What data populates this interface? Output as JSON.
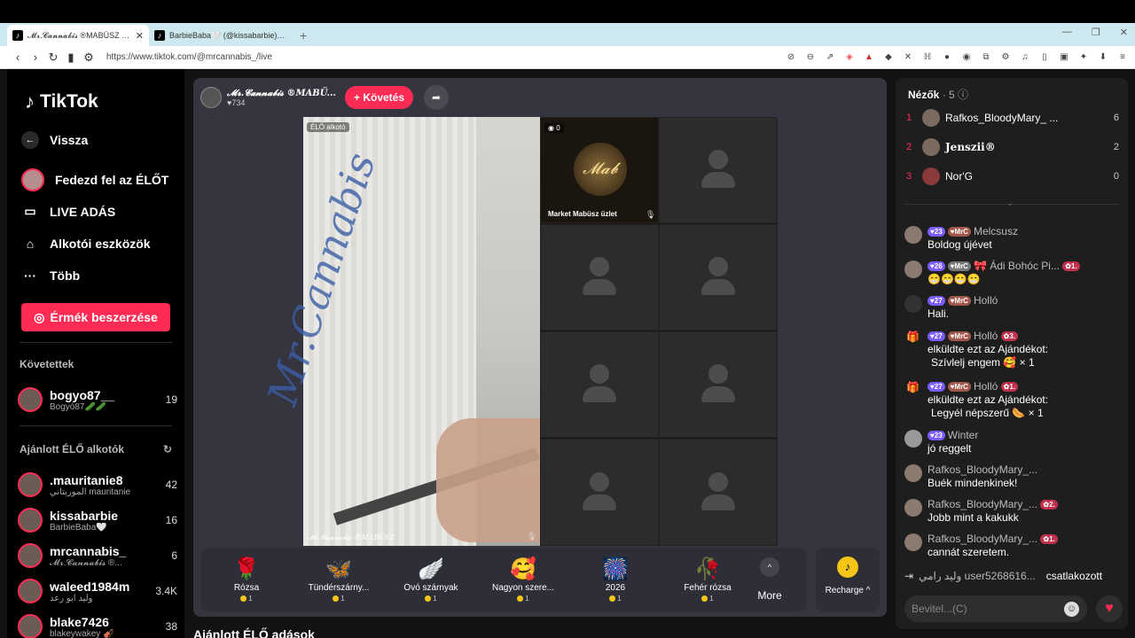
{
  "browser": {
    "tabs": [
      {
        "title": "𝓜𝓻.𝓒𝓪𝓷𝓷𝓪𝓫𝓲𝓼 ®MABÜSZ (@"
      },
      {
        "title": "BarbieBaba🤍 (@kissabarbie) ÉL"
      }
    ],
    "url": "https://www.tiktok.com/@mrcannabis_/live"
  },
  "sidebar": {
    "logo": "TikTok",
    "back": "Vissza",
    "nav": [
      {
        "label": "Fedezd fel az ÉLŐT",
        "icon": "avatar-icon"
      },
      {
        "label": "LIVE ADÁS",
        "icon": "video-icon"
      },
      {
        "label": "Alkotói eszközök",
        "icon": "creator-tools-icon"
      },
      {
        "label": "Több",
        "icon": "more-dots-icon"
      }
    ],
    "coins_button": "Érmék beszerzése",
    "following_header": "Követettek",
    "following": [
      {
        "name": "bogyo87__",
        "sub": "Bogyó87🥒🥒",
        "count": "19"
      }
    ],
    "recommended_header": "Ajánlott ÉLŐ alkotók",
    "recommended": [
      {
        "name": ".mauritanie8",
        "sub": "الموريتاني mauritanie",
        "count": "42"
      },
      {
        "name": "kissabarbie",
        "sub": "BarbieBaba🤍",
        "count": "16"
      },
      {
        "name": "mrcannabis_",
        "sub": "𝓜𝓻.𝓒𝓪𝓷𝓷𝓪𝓫𝓲𝓼 ®...",
        "count": "6"
      },
      {
        "name": "waleed1984m",
        "sub": "وليد ابو رعد",
        "count": "3.4K"
      },
      {
        "name": "blake7426",
        "sub": "blakeywakey 🎻",
        "count": "38"
      }
    ]
  },
  "stream": {
    "host_name": "𝓜𝓻.𝓒𝓪𝓷𝓷𝓪𝓫𝓲𝓼 ®MABÜ...",
    "host_likes": "♥734",
    "follow_button": "+ Követés",
    "live_creator_label": "ÉLŐ alkotó",
    "main_feed_name": "𝓜𝓻.𝓒𝓪𝓷𝓷𝓪𝓫𝓲𝓼 ®MABÜSZ",
    "guest_count": "0",
    "market_name": "Market Mabüsz üzlet"
  },
  "gifts": [
    {
      "name": "Rózsa",
      "price": "1",
      "icon": "🌹"
    },
    {
      "name": "Tündérszárny...",
      "price": "1",
      "icon": "🦋"
    },
    {
      "name": "Óvó szárnyak",
      "price": "1",
      "icon": "🪽"
    },
    {
      "name": "Nagyon szere...",
      "price": "1",
      "icon": "🥰"
    },
    {
      "name": "2026",
      "price": "1",
      "icon": "🎆"
    },
    {
      "name": "Fehér rózsa",
      "price": "1",
      "icon": "🥀"
    }
  ],
  "more_label": "More",
  "recharge_label": "Recharge ^",
  "recommended_lives_header": "Ajánlott ÉLŐ adások",
  "viewers": {
    "header": "Nézők",
    "count": "· 5",
    "list": [
      {
        "rank": "1",
        "name": "Rafkos_BloodyMary_ ...",
        "score": "6"
      },
      {
        "rank": "2",
        "name": "Jenszii®",
        "score": "2"
      },
      {
        "rank": "3",
        "name": "Nor'G",
        "score": "0"
      }
    ]
  },
  "chat": [
    {
      "level": "23",
      "club": "MrC",
      "name": "Melcsusz",
      "text": "Boldog újévet",
      "type": "msg"
    },
    {
      "level": "26",
      "club": "MrC",
      "name": "🎀 Ádi Bohóc Pi...",
      "rank": "1.",
      "text": "😁😁😁😁",
      "type": "msg"
    },
    {
      "level": "27",
      "club": "MrC",
      "name": "Holló",
      "text": "Hali.",
      "type": "msg"
    },
    {
      "level": "27",
      "club": "MrC",
      "name": "Holló",
      "rank": "3.",
      "text": "elküldte ezt az Ajándékot:",
      "text2": "Szívlelj engem 🥰 × 1",
      "type": "gift"
    },
    {
      "level": "27",
      "club": "MrC",
      "name": "Holló",
      "rank": "1.",
      "text": "elküldte ezt az Ajándékot:",
      "text2": "Legyél népszerű 🌭 × 1",
      "type": "gift"
    },
    {
      "level": "23",
      "name": "Winter",
      "text": "jó reggelt",
      "type": "msg"
    },
    {
      "name": "Rafkos_BloodyMary_...",
      "text": "Buék mindenkinek!",
      "type": "msg"
    },
    {
      "name": "Rafkos_BloodyMary_...",
      "rank": "2.",
      "text": "Jobb mint a kakukk",
      "type": "msg"
    },
    {
      "name": "Rafkos_BloodyMary_...",
      "rank": "1.",
      "text": "cannát szeretem.",
      "type": "msg"
    }
  ],
  "joined": {
    "user": "وليد رامي user5268616...",
    "text": "csatlakozott"
  },
  "input_placeholder": "Bevitel...(C)"
}
